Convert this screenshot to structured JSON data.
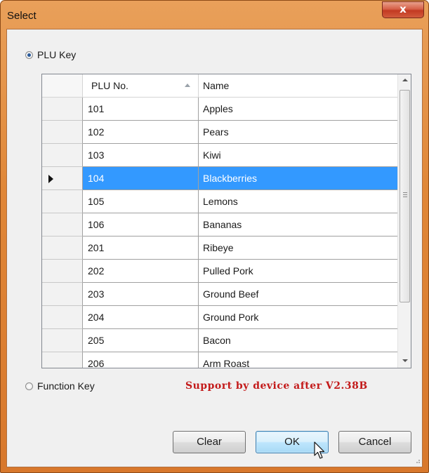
{
  "window": {
    "title": "Select",
    "close_glyph": "x"
  },
  "plu_key": {
    "label": "PLU Key",
    "checked": true
  },
  "function_key": {
    "label": "Function Key",
    "checked": false
  },
  "grid": {
    "columns": [
      "PLU No.",
      "Name"
    ],
    "sorted_column": "PLU No.",
    "sort_direction": "ascending",
    "rows": [
      {
        "plu": "101",
        "name": "Apples"
      },
      {
        "plu": "102",
        "name": "Pears"
      },
      {
        "plu": "103",
        "name": "Kiwi"
      },
      {
        "plu": "104",
        "name": "Blackberries",
        "selected": true
      },
      {
        "plu": "105",
        "name": "Lemons"
      },
      {
        "plu": "106",
        "name": "Bananas"
      },
      {
        "plu": "201",
        "name": "Ribeye"
      },
      {
        "plu": "202",
        "name": "Pulled Pork"
      },
      {
        "plu": "203",
        "name": "Ground Beef"
      },
      {
        "plu": "204",
        "name": "Ground Pork"
      },
      {
        "plu": "205",
        "name": "Bacon"
      },
      {
        "plu": "206",
        "name": "Arm Roast"
      }
    ]
  },
  "note": "Support by device after V2.38B",
  "buttons": {
    "clear": "Clear",
    "ok": "OK",
    "cancel": "Cancel"
  },
  "colors": {
    "title_bar": "#e08738",
    "selection": "#3399ff",
    "note_text": "#c31a1a",
    "close_button": "#c23a22"
  },
  "icons": {
    "close": "close-icon",
    "row_pointer": "row-pointer-icon",
    "sort": "sort-ascending-icon",
    "cursor": "mouse-pointer-icon"
  }
}
